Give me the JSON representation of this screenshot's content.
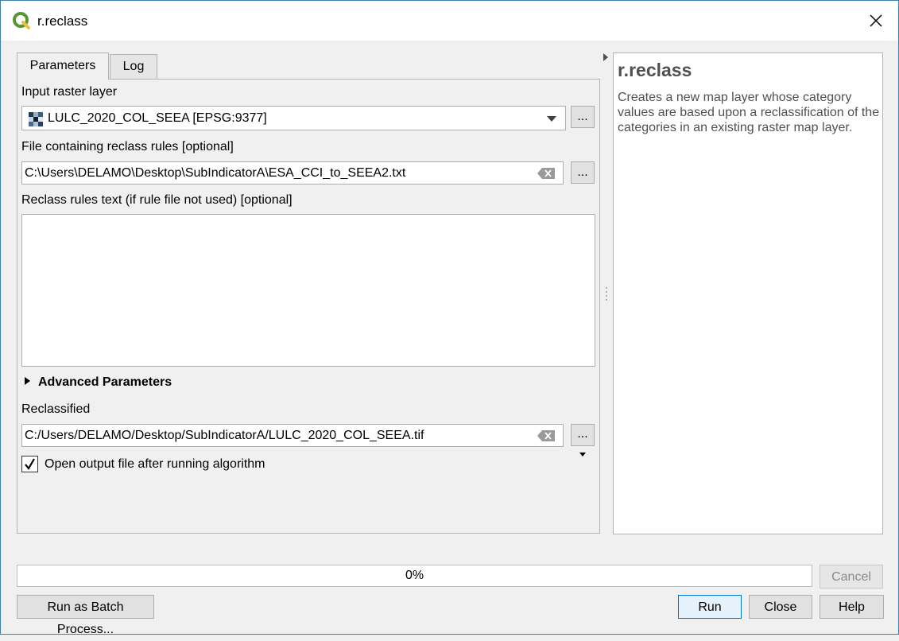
{
  "window": {
    "title": "r.reclass",
    "accent_color": "#589632"
  },
  "tabs": [
    {
      "label": "Parameters",
      "active": true
    },
    {
      "label": "Log",
      "active": false
    }
  ],
  "params": {
    "input_raster_label": "Input raster layer",
    "input_raster_value": "LULC_2020_COL_SEEA [EPSG:9377]",
    "rules_file_label": "File containing reclass rules [optional]",
    "rules_file_value": "C:\\Users\\DELAMO\\Desktop\\SubIndicatorA\\ESA_CCI_to_SEEA2.txt",
    "rules_text_label": "Reclass rules text (if rule file not used) [optional]",
    "rules_text_value": "",
    "advanced_label": "Advanced Parameters",
    "reclassified_label": "Reclassified",
    "reclassified_value": "C:/Users/DELAMO/Desktop/SubIndicatorA/LULC_2020_COL_SEEA.tif",
    "open_output_label": "Open output file after running algorithm",
    "open_output_checked": true,
    "browse_label": "..."
  },
  "help": {
    "title": "r.reclass",
    "description": "Creates a new map layer whose category values are based upon a reclassification of the categories in an existing raster map layer."
  },
  "progress": {
    "percent": 0,
    "label": "0%"
  },
  "buttons": {
    "cancel": "Cancel",
    "batch": "Run as Batch Process...",
    "run": "Run",
    "close": "Close",
    "help": "Help"
  }
}
